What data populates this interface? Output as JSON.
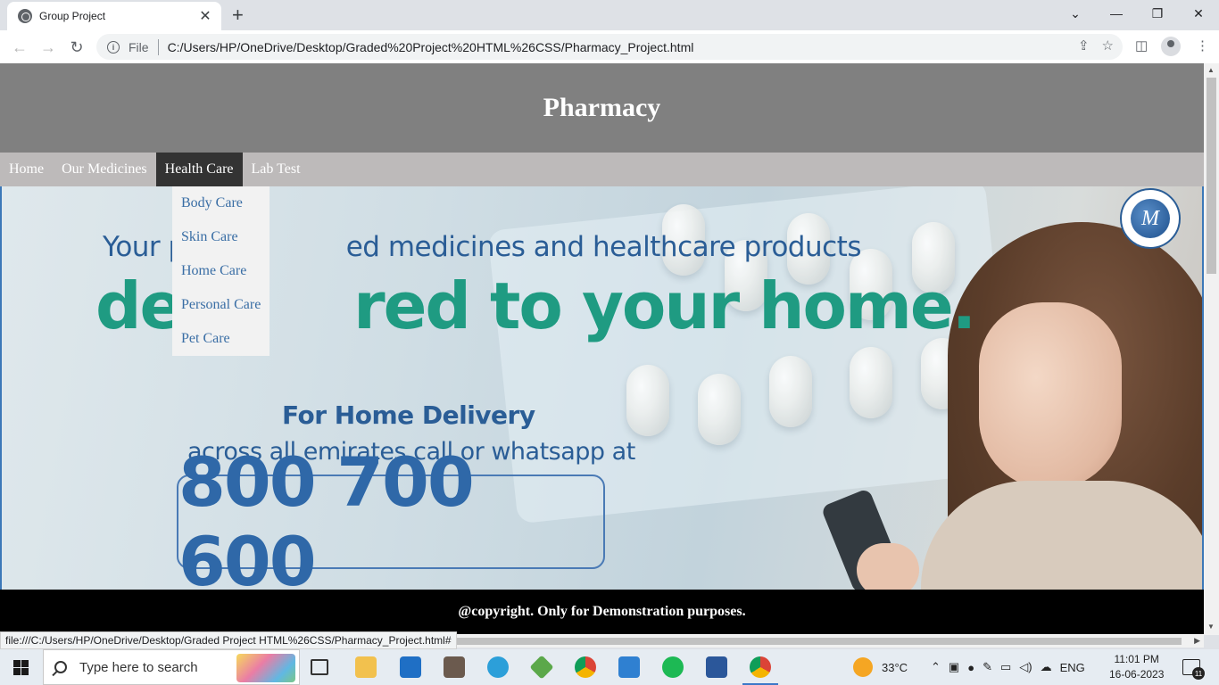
{
  "browser": {
    "tab_title": "Group Project",
    "tab_close": "✕",
    "new_tab": "+",
    "file_label": "File",
    "url": "C:/Users/HP/OneDrive/Desktop/Graded%20Project%20HTML%26CSS/Pharmacy_Project.html",
    "status_url": "file:///C:/Users/HP/OneDrive/Desktop/Graded Project HTML%26CSS/Pharmacy_Project.html#"
  },
  "site": {
    "title": "Pharmacy",
    "nav": [
      {
        "label": "Home"
      },
      {
        "label": "Our Medicines"
      },
      {
        "label": "Health Care"
      },
      {
        "label": "Lab Test"
      }
    ],
    "active_nav": "Health Care",
    "dropdown": [
      {
        "label": "Body Care"
      },
      {
        "label": "Skin Care"
      },
      {
        "label": "Home Care"
      },
      {
        "label": "Personal Care"
      },
      {
        "label": "Pet Care"
      }
    ],
    "banner": {
      "line1_visible": "Your p",
      "line1_rest": "ed medicines and healthcare products",
      "line2_visible": "del",
      "line2_rest": "red to your home.",
      "line3": "For Home Delivery",
      "line4": "across all emirates call or whatsapp at",
      "phone": "800 700 600",
      "logo_letter": "M",
      "colors": {
        "blue": "#2a5d96",
        "green": "#1f9b82"
      }
    },
    "footer": "@copyright. Only for Demonstration purposes."
  },
  "taskbar": {
    "search_placeholder": "Type here to search",
    "weather": "33°C",
    "language": "ENG",
    "time": "11:01 PM",
    "date": "16-06-2023",
    "notification_count": "11"
  }
}
